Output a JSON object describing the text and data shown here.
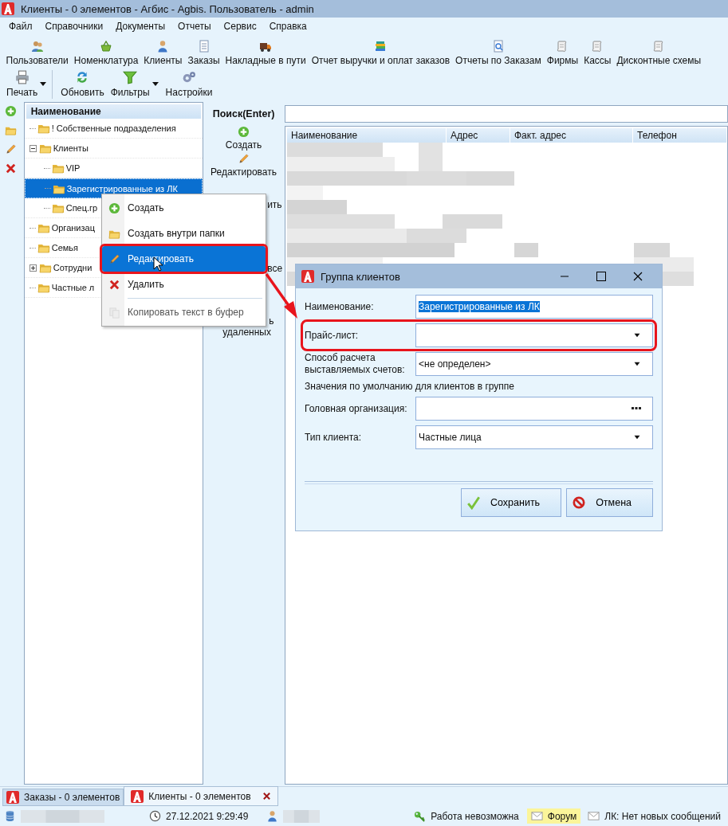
{
  "window": {
    "title": "Клиенты - 0 элементов - Агбис - Agbis. Пользователь -  admin"
  },
  "menu": [
    "Файл",
    "Справочники",
    "Документы",
    "Отчеты",
    "Сервис",
    "Справка"
  ],
  "toolbar": [
    {
      "label": "Пользователи"
    },
    {
      "label": "Номенклатура"
    },
    {
      "label": "Клиенты"
    },
    {
      "label": "Заказы"
    },
    {
      "label": "Накладные в пути"
    },
    {
      "label": "Отчет выручки и оплат заказов"
    },
    {
      "label": "Отчеты по Заказам"
    },
    {
      "label": "Фирмы"
    },
    {
      "label": "Кассы"
    },
    {
      "label": "Дисконтные схемы"
    }
  ],
  "toolbar2": [
    {
      "label": "Печать",
      "dropdown": true
    },
    {
      "label": "Обновить",
      "dropdown": false
    },
    {
      "label": "Фильтры",
      "dropdown": true
    },
    {
      "label": "Настройки",
      "dropdown": false
    }
  ],
  "tree": {
    "header": "Наименование",
    "items": [
      {
        "label": "! Собственные подразделения",
        "selected": false
      },
      {
        "label": "Клиенты",
        "selected": false,
        "expanded": true,
        "children": [
          {
            "label": "VIP",
            "selected": false
          },
          {
            "label": "Зарегистрированные из ЛК",
            "selected": true
          },
          {
            "label": "Спец.гр",
            "selected": false
          }
        ]
      },
      {
        "label": "Организац",
        "selected": false
      },
      {
        "label": "Семья",
        "selected": false
      },
      {
        "label": "Сотрудни",
        "selected": false,
        "expanded": false
      },
      {
        "label": "Частные л",
        "selected": false
      }
    ]
  },
  "search": {
    "label": "Поиск(Enter)"
  },
  "actions": [
    {
      "label": "Создать"
    },
    {
      "label": "Редактировать"
    }
  ],
  "covered_action_fragments": [
    "ить",
    "все",
    "ь",
    "удаленных"
  ],
  "grid": {
    "columns": [
      "Наименование",
      "Адрес",
      "Факт. адрес",
      "Телефон"
    ]
  },
  "context_menu": {
    "items": [
      {
        "kind": "item",
        "label": "Создать",
        "selected": false,
        "disabled": false,
        "highlighted": false
      },
      {
        "kind": "item",
        "label": "Создать внутри папки",
        "selected": false,
        "disabled": false,
        "highlighted": false
      },
      {
        "kind": "item",
        "label": "Редактировать",
        "selected": true,
        "disabled": false,
        "highlighted": true
      },
      {
        "kind": "item",
        "label": "Удалить",
        "selected": false,
        "disabled": false,
        "highlighted": false
      },
      {
        "kind": "separator"
      },
      {
        "kind": "item",
        "label": "Копировать текст в буфер",
        "selected": false,
        "disabled": true,
        "highlighted": false
      }
    ]
  },
  "dialog": {
    "title": "Группа клиентов",
    "fields": [
      {
        "kind": "text",
        "label": "Наименование:",
        "value": "Зарегистрированные из ЛК",
        "text_selected": true,
        "highlighted": false
      },
      {
        "kind": "dropdown",
        "label": "Прайс-лист:",
        "highlighted": true
      },
      {
        "kind": "dropdown",
        "label": "Способ расчета выставляемых счетов:",
        "value": "<не определен>",
        "highlighted": false
      },
      {
        "kind": "note",
        "label": "Значения по умолчанию для клиентов в группе"
      },
      {
        "kind": "lookup",
        "label": "Головная организация:",
        "highlighted": false
      },
      {
        "kind": "dropdown",
        "label": "Тип клиента:",
        "value": "Частные лица",
        "highlighted": false
      }
    ],
    "buttons": [
      {
        "kind": "save",
        "label": "Сохранить"
      },
      {
        "kind": "cancel",
        "label": "Отмена"
      }
    ]
  },
  "tabs": [
    {
      "label": "Заказы - 0 элементов",
      "selected": false,
      "closable": false
    },
    {
      "label": "Клиенты - 0 элементов",
      "selected": true,
      "closable": true
    }
  ],
  "status_bar": [
    {
      "kind": "db"
    },
    {
      "kind": "clock",
      "text": "27.12.2021 9:29:49"
    },
    {
      "kind": "user"
    },
    {
      "kind": "key",
      "text": "Работа невозможна"
    },
    {
      "kind": "mail",
      "text": "Форум",
      "highlighted": true
    },
    {
      "kind": "mail",
      "text": "ЛК: Нет новых сообщений",
      "highlighted": false
    }
  ]
}
